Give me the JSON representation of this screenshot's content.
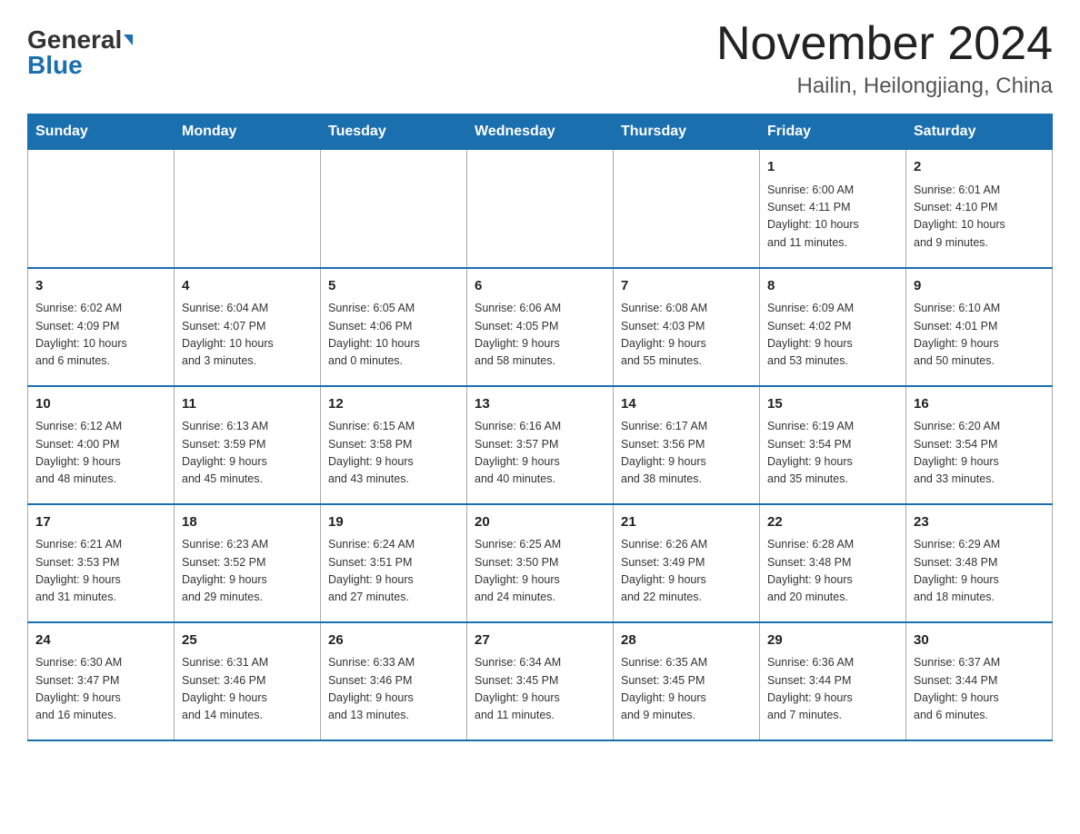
{
  "logo": {
    "text1": "General",
    "text2": "Blue"
  },
  "title": "November 2024",
  "location": "Hailin, Heilongjiang, China",
  "days_of_week": [
    "Sunday",
    "Monday",
    "Tuesday",
    "Wednesday",
    "Thursday",
    "Friday",
    "Saturday"
  ],
  "weeks": [
    [
      {
        "day": "",
        "info": ""
      },
      {
        "day": "",
        "info": ""
      },
      {
        "day": "",
        "info": ""
      },
      {
        "day": "",
        "info": ""
      },
      {
        "day": "",
        "info": ""
      },
      {
        "day": "1",
        "info": "Sunrise: 6:00 AM\nSunset: 4:11 PM\nDaylight: 10 hours\nand 11 minutes."
      },
      {
        "day": "2",
        "info": "Sunrise: 6:01 AM\nSunset: 4:10 PM\nDaylight: 10 hours\nand 9 minutes."
      }
    ],
    [
      {
        "day": "3",
        "info": "Sunrise: 6:02 AM\nSunset: 4:09 PM\nDaylight: 10 hours\nand 6 minutes."
      },
      {
        "day": "4",
        "info": "Sunrise: 6:04 AM\nSunset: 4:07 PM\nDaylight: 10 hours\nand 3 minutes."
      },
      {
        "day": "5",
        "info": "Sunrise: 6:05 AM\nSunset: 4:06 PM\nDaylight: 10 hours\nand 0 minutes."
      },
      {
        "day": "6",
        "info": "Sunrise: 6:06 AM\nSunset: 4:05 PM\nDaylight: 9 hours\nand 58 minutes."
      },
      {
        "day": "7",
        "info": "Sunrise: 6:08 AM\nSunset: 4:03 PM\nDaylight: 9 hours\nand 55 minutes."
      },
      {
        "day": "8",
        "info": "Sunrise: 6:09 AM\nSunset: 4:02 PM\nDaylight: 9 hours\nand 53 minutes."
      },
      {
        "day": "9",
        "info": "Sunrise: 6:10 AM\nSunset: 4:01 PM\nDaylight: 9 hours\nand 50 minutes."
      }
    ],
    [
      {
        "day": "10",
        "info": "Sunrise: 6:12 AM\nSunset: 4:00 PM\nDaylight: 9 hours\nand 48 minutes."
      },
      {
        "day": "11",
        "info": "Sunrise: 6:13 AM\nSunset: 3:59 PM\nDaylight: 9 hours\nand 45 minutes."
      },
      {
        "day": "12",
        "info": "Sunrise: 6:15 AM\nSunset: 3:58 PM\nDaylight: 9 hours\nand 43 minutes."
      },
      {
        "day": "13",
        "info": "Sunrise: 6:16 AM\nSunset: 3:57 PM\nDaylight: 9 hours\nand 40 minutes."
      },
      {
        "day": "14",
        "info": "Sunrise: 6:17 AM\nSunset: 3:56 PM\nDaylight: 9 hours\nand 38 minutes."
      },
      {
        "day": "15",
        "info": "Sunrise: 6:19 AM\nSunset: 3:54 PM\nDaylight: 9 hours\nand 35 minutes."
      },
      {
        "day": "16",
        "info": "Sunrise: 6:20 AM\nSunset: 3:54 PM\nDaylight: 9 hours\nand 33 minutes."
      }
    ],
    [
      {
        "day": "17",
        "info": "Sunrise: 6:21 AM\nSunset: 3:53 PM\nDaylight: 9 hours\nand 31 minutes."
      },
      {
        "day": "18",
        "info": "Sunrise: 6:23 AM\nSunset: 3:52 PM\nDaylight: 9 hours\nand 29 minutes."
      },
      {
        "day": "19",
        "info": "Sunrise: 6:24 AM\nSunset: 3:51 PM\nDaylight: 9 hours\nand 27 minutes."
      },
      {
        "day": "20",
        "info": "Sunrise: 6:25 AM\nSunset: 3:50 PM\nDaylight: 9 hours\nand 24 minutes."
      },
      {
        "day": "21",
        "info": "Sunrise: 6:26 AM\nSunset: 3:49 PM\nDaylight: 9 hours\nand 22 minutes."
      },
      {
        "day": "22",
        "info": "Sunrise: 6:28 AM\nSunset: 3:48 PM\nDaylight: 9 hours\nand 20 minutes."
      },
      {
        "day": "23",
        "info": "Sunrise: 6:29 AM\nSunset: 3:48 PM\nDaylight: 9 hours\nand 18 minutes."
      }
    ],
    [
      {
        "day": "24",
        "info": "Sunrise: 6:30 AM\nSunset: 3:47 PM\nDaylight: 9 hours\nand 16 minutes."
      },
      {
        "day": "25",
        "info": "Sunrise: 6:31 AM\nSunset: 3:46 PM\nDaylight: 9 hours\nand 14 minutes."
      },
      {
        "day": "26",
        "info": "Sunrise: 6:33 AM\nSunset: 3:46 PM\nDaylight: 9 hours\nand 13 minutes."
      },
      {
        "day": "27",
        "info": "Sunrise: 6:34 AM\nSunset: 3:45 PM\nDaylight: 9 hours\nand 11 minutes."
      },
      {
        "day": "28",
        "info": "Sunrise: 6:35 AM\nSunset: 3:45 PM\nDaylight: 9 hours\nand 9 minutes."
      },
      {
        "day": "29",
        "info": "Sunrise: 6:36 AM\nSunset: 3:44 PM\nDaylight: 9 hours\nand 7 minutes."
      },
      {
        "day": "30",
        "info": "Sunrise: 6:37 AM\nSunset: 3:44 PM\nDaylight: 9 hours\nand 6 minutes."
      }
    ]
  ]
}
